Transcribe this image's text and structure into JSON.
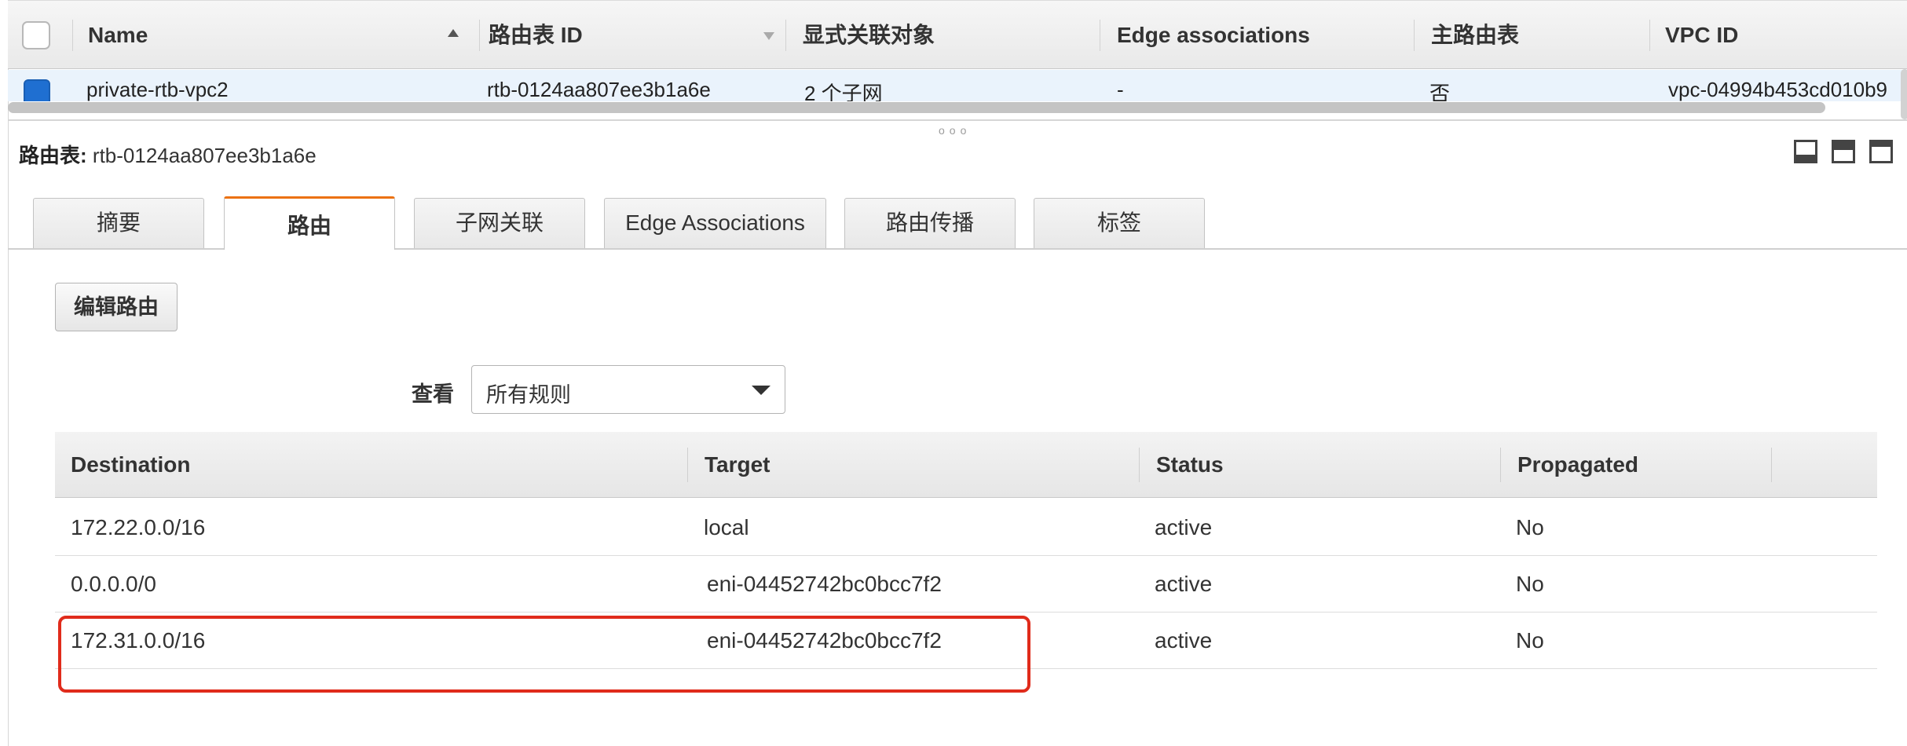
{
  "top_table": {
    "columns": [
      "Name",
      "路由表 ID",
      "显式关联对象",
      "Edge associations",
      "主路由表",
      "VPC ID"
    ],
    "row": {
      "name": "private-rtb-vpc2",
      "route_table_id": "rtb-0124aa807ee3b1a6e",
      "explicit_associations": "2 个子网",
      "edge_associations": "-",
      "main": "否",
      "vpc_id": "vpc-04994b453cd010b9"
    }
  },
  "detail": {
    "label": "路由表:",
    "value": "rtb-0124aa807ee3b1a6e"
  },
  "tabs": [
    "摘要",
    "路由",
    "子网关联",
    "Edge Associations",
    "路由传播",
    "标签"
  ],
  "active_tab": "路由",
  "edit_button": "编辑路由",
  "view": {
    "label": "查看",
    "selected": "所有规则"
  },
  "routes": {
    "columns": [
      "Destination",
      "Target",
      "Status",
      "Propagated"
    ],
    "rows": [
      {
        "destination": "172.22.0.0/16",
        "target": "local",
        "status": "active",
        "propagated": "No"
      },
      {
        "destination": "0.0.0.0/0",
        "target": "eni-04452742bc0bcc7f2",
        "status": "active",
        "propagated": "No"
      },
      {
        "destination": "172.31.0.0/16",
        "target": "eni-04452742bc0bcc7f2",
        "status": "active",
        "propagated": "No"
      }
    ]
  },
  "colors": {
    "accent_tab": "#ec7211",
    "link": "#0b5cab",
    "status_active": "#1d8102",
    "highlight": "#e02b1b",
    "selected_row": "#eaf3fc"
  }
}
